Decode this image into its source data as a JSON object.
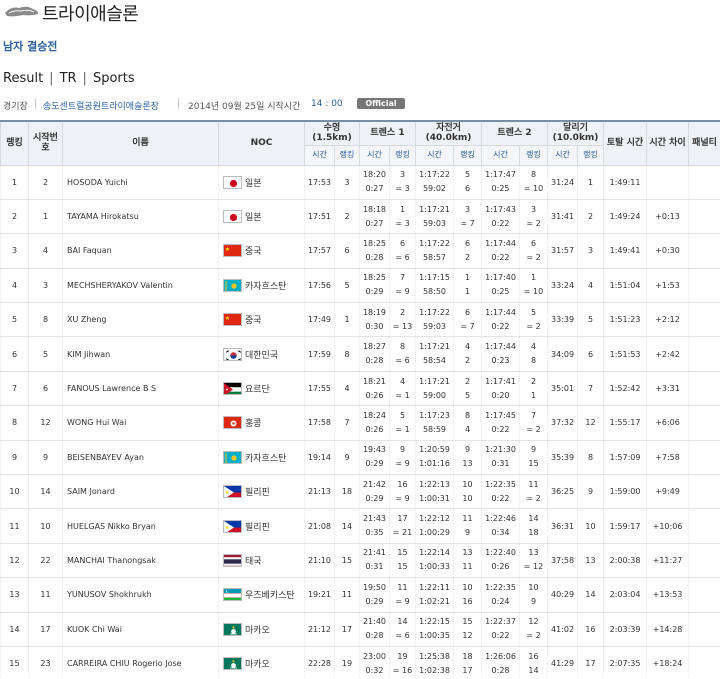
{
  "header": {
    "sport_title": "트라이애슬론",
    "logo_icon": "triathlon-hand-logo-icon"
  },
  "event": {
    "name": "남자 결승전"
  },
  "tabs": [
    {
      "label": "Result"
    },
    {
      "label": "TR"
    },
    {
      "label": "Sports"
    }
  ],
  "tab_separator": "|",
  "info": {
    "venue_label": "경기장",
    "venue": "송도센트럴공원트라이애슬론장",
    "date": "2014년 09월 25일  시작시간",
    "time": "14 : 00",
    "status_badge": "Official"
  },
  "columns": {
    "rank": "랭킹",
    "start_no": "시작번호",
    "name": "이름",
    "noc": "NOC",
    "swim": "수영(1.5km)",
    "t1": "트렌스 1",
    "bike": "자전거(40.0km)",
    "t2": "트렌스 2",
    "run": "달리기(10.0km)",
    "total": "토탈 시간",
    "diff": "시간 차이",
    "penalty": "패널티",
    "sub_time": "시간",
    "sub_rank": "랭킹"
  },
  "colors": {
    "header_bg": "#eef1f5",
    "accent_blue": "#2a5d9f",
    "badge_gray": "#777777"
  },
  "rows": [
    {
      "rank": "1",
      "start": "2",
      "name": "HOSODA Yuichi",
      "noc": "일본",
      "flag": "japan",
      "swim_time": "17:53",
      "swim_rank": "3",
      "t1_time": [
        "18:20",
        "0:27"
      ],
      "t1_rank": [
        "3",
        "= 3"
      ],
      "bike_time": [
        "1:17:22",
        "59:02"
      ],
      "bike_rank": [
        "5",
        "6"
      ],
      "t2_time": [
        "1:17:47",
        "0:25"
      ],
      "t2_rank": [
        "8",
        "= 10"
      ],
      "run_time": "31:24",
      "run_rank": "1",
      "total": "1:49:11",
      "diff": "",
      "penalty": ""
    },
    {
      "rank": "2",
      "start": "1",
      "name": "TAYAMA Hirokatsu",
      "noc": "일본",
      "flag": "japan",
      "swim_time": "17:51",
      "swim_rank": "2",
      "t1_time": [
        "18:18",
        "0:27"
      ],
      "t1_rank": [
        "1",
        "= 3"
      ],
      "bike_time": [
        "1:17:21",
        "59:03"
      ],
      "bike_rank": [
        "3",
        "= 7"
      ],
      "t2_time": [
        "1:17:43",
        "0:22"
      ],
      "t2_rank": [
        "3",
        "= 2"
      ],
      "run_time": "31:41",
      "run_rank": "2",
      "total": "1:49:24",
      "diff": "+0:13",
      "penalty": ""
    },
    {
      "rank": "3",
      "start": "4",
      "name": "BAI Faquan",
      "noc": "중국",
      "flag": "china",
      "swim_time": "17:57",
      "swim_rank": "6",
      "t1_time": [
        "18:25",
        "0:28"
      ],
      "t1_rank": [
        "6",
        "= 6"
      ],
      "bike_time": [
        "1:17:22",
        "58:57"
      ],
      "bike_rank": [
        "6",
        "2"
      ],
      "t2_time": [
        "1:17:44",
        "0:22"
      ],
      "t2_rank": [
        "6",
        "= 2"
      ],
      "run_time": "31:57",
      "run_rank": "3",
      "total": "1:49:41",
      "diff": "+0:30",
      "penalty": ""
    },
    {
      "rank": "4",
      "start": "3",
      "name": "MECHSHERYAKOV Valentin",
      "noc": "카자흐스탄",
      "flag": "kazakhstan",
      "swim_time": "17:56",
      "swim_rank": "5",
      "t1_time": [
        "18:25",
        "0:29"
      ],
      "t1_rank": [
        "7",
        "= 9"
      ],
      "bike_time": [
        "1:17:15",
        "58:50"
      ],
      "bike_rank": [
        "1",
        "1"
      ],
      "t2_time": [
        "1:17:40",
        "0:25"
      ],
      "t2_rank": [
        "1",
        "= 10"
      ],
      "run_time": "33:24",
      "run_rank": "4",
      "total": "1:51:04",
      "diff": "+1:53",
      "penalty": ""
    },
    {
      "rank": "5",
      "start": "8",
      "name": "XU Zheng",
      "noc": "중국",
      "flag": "china",
      "swim_time": "17:49",
      "swim_rank": "1",
      "t1_time": [
        "18:19",
        "0:30"
      ],
      "t1_rank": [
        "2",
        "= 13"
      ],
      "bike_time": [
        "1:17:22",
        "59:03"
      ],
      "bike_rank": [
        "6",
        "= 7"
      ],
      "t2_time": [
        "1:17:44",
        "0:22"
      ],
      "t2_rank": [
        "5",
        "= 2"
      ],
      "run_time": "33:39",
      "run_rank": "5",
      "total": "1:51:23",
      "diff": "+2:12",
      "penalty": ""
    },
    {
      "rank": "6",
      "start": "5",
      "name": "KIM Jihwan",
      "noc": "대한민국",
      "flag": "korea",
      "swim_time": "17:59",
      "swim_rank": "8",
      "t1_time": [
        "18:27",
        "0:28"
      ],
      "t1_rank": [
        "8",
        "= 6"
      ],
      "bike_time": [
        "1:17:21",
        "58:54"
      ],
      "bike_rank": [
        "4",
        "2"
      ],
      "t2_time": [
        "1:17:44",
        "0:23"
      ],
      "t2_rank": [
        "4",
        "8"
      ],
      "run_time": "34:09",
      "run_rank": "6",
      "total": "1:51:53",
      "diff": "+2:42",
      "penalty": ""
    },
    {
      "rank": "7",
      "start": "6",
      "name": "FANOUS Lawrence B S",
      "noc": "요르단",
      "flag": "jordan",
      "swim_time": "17:55",
      "swim_rank": "4",
      "t1_time": [
        "18:21",
        "0:26"
      ],
      "t1_rank": [
        "4",
        "= 1"
      ],
      "bike_time": [
        "1:17:21",
        "59:00"
      ],
      "bike_rank": [
        "2",
        "5"
      ],
      "t2_time": [
        "1:17:41",
        "0:20"
      ],
      "t2_rank": [
        "2",
        "1"
      ],
      "run_time": "35:01",
      "run_rank": "7",
      "total": "1:52:42",
      "diff": "+3:31",
      "penalty": ""
    },
    {
      "rank": "8",
      "start": "12",
      "name": "WONG Hui Wai",
      "noc": "홍콩",
      "flag": "hongkong",
      "swim_time": "17:58",
      "swim_rank": "7",
      "t1_time": [
        "18:24",
        "0:26"
      ],
      "t1_rank": [
        "5",
        "= 1"
      ],
      "bike_time": [
        "1:17:23",
        "58:59"
      ],
      "bike_rank": [
        "8",
        "4"
      ],
      "t2_time": [
        "1:17:45",
        "0:22"
      ],
      "t2_rank": [
        "7",
        "= 2"
      ],
      "run_time": "37:32",
      "run_rank": "12",
      "total": "1:55:17",
      "diff": "+6:06",
      "penalty": ""
    },
    {
      "rank": "9",
      "start": "9",
      "name": "BEISENBAYEV Ayan",
      "noc": "카자흐스탄",
      "flag": "kazakhstan",
      "swim_time": "19:14",
      "swim_rank": "9",
      "t1_time": [
        "19:43",
        "0:29"
      ],
      "t1_rank": [
        "9",
        "= 9"
      ],
      "bike_time": [
        "1:20:59",
        "1:01:16"
      ],
      "bike_rank": [
        "9",
        "13"
      ],
      "t2_time": [
        "1:21:30",
        "0:31"
      ],
      "t2_rank": [
        "9",
        "15"
      ],
      "run_time": "35:39",
      "run_rank": "8",
      "total": "1:57:09",
      "diff": "+7:58",
      "penalty": ""
    },
    {
      "rank": "10",
      "start": "14",
      "name": "SAIM Jonard",
      "noc": "필리핀",
      "flag": "philippines",
      "swim_time": "21:13",
      "swim_rank": "18",
      "t1_time": [
        "21:42",
        "0:29"
      ],
      "t1_rank": [
        "16",
        "= 9"
      ],
      "bike_time": [
        "1:22:13",
        "1:00:31"
      ],
      "bike_rank": [
        "10",
        "10"
      ],
      "t2_time": [
        "1:22:35",
        "0:22"
      ],
      "t2_rank": [
        "11",
        "= 2"
      ],
      "run_time": "36:25",
      "run_rank": "9",
      "total": "1:59:00",
      "diff": "+9:49",
      "penalty": ""
    },
    {
      "rank": "11",
      "start": "10",
      "name": "HUELGAS Nikko Bryan",
      "noc": "필리핀",
      "flag": "philippines",
      "swim_time": "21:08",
      "swim_rank": "14",
      "t1_time": [
        "21:43",
        "0:35"
      ],
      "t1_rank": [
        "17",
        "= 21"
      ],
      "bike_time": [
        "1:22:12",
        "1:00:29"
      ],
      "bike_rank": [
        "11",
        "9"
      ],
      "t2_time": [
        "1:22:46",
        "0:34"
      ],
      "t2_rank": [
        "14",
        "18"
      ],
      "run_time": "36:31",
      "run_rank": "10",
      "total": "1:59:17",
      "diff": "+10:06",
      "penalty": ""
    },
    {
      "rank": "12",
      "start": "22",
      "name": "MANCHAI Thanongsak",
      "noc": "태국",
      "flag": "thailand",
      "swim_time": "21:10",
      "swim_rank": "15",
      "t1_time": [
        "21:41",
        "0:31"
      ],
      "t1_rank": [
        "15",
        "15"
      ],
      "bike_time": [
        "1:22:14",
        "1:00:33"
      ],
      "bike_rank": [
        "13",
        "11"
      ],
      "t2_time": [
        "1:22:40",
        "0:26"
      ],
      "t2_rank": [
        "13",
        "= 12"
      ],
      "run_time": "37:58",
      "run_rank": "13",
      "total": "2:00:38",
      "diff": "+11:27",
      "penalty": ""
    },
    {
      "rank": "13",
      "start": "11",
      "name": "YUNUSOV Shokhrukh",
      "noc": "우즈베키스탄",
      "flag": "uzbekistan",
      "swim_time": "19:21",
      "swim_rank": "11",
      "t1_time": [
        "19:50",
        "0:29"
      ],
      "t1_rank": [
        "11",
        "= 9"
      ],
      "bike_time": [
        "1:22:11",
        "1:02:21"
      ],
      "bike_rank": [
        "10",
        "16"
      ],
      "t2_time": [
        "1:22:35",
        "0:24"
      ],
      "t2_rank": [
        "10",
        "9"
      ],
      "run_time": "40:29",
      "run_rank": "14",
      "total": "2:03:04",
      "diff": "+13:53",
      "penalty": ""
    },
    {
      "rank": "14",
      "start": "17",
      "name": "KUOK Chi Wai",
      "noc": "마카오",
      "flag": "macau",
      "swim_time": "21:12",
      "swim_rank": "17",
      "t1_time": [
        "21:40",
        "0:28"
      ],
      "t1_rank": [
        "14",
        "= 6"
      ],
      "bike_time": [
        "1:22:15",
        "1:00:35"
      ],
      "bike_rank": [
        "15",
        "12"
      ],
      "t2_time": [
        "1:22:37",
        "0:22"
      ],
      "t2_rank": [
        "12",
        "= 2"
      ],
      "run_time": "41:02",
      "run_rank": "16",
      "total": "2:03:39",
      "diff": "+14:28",
      "penalty": ""
    },
    {
      "rank": "15",
      "start": "23",
      "name": "CARREIRA CHIU Rogerio Jose",
      "noc": "마카오",
      "flag": "macau",
      "swim_time": "22:28",
      "swim_rank": "19",
      "t1_time": [
        "23:00",
        "0:32"
      ],
      "t1_rank": [
        "19",
        "= 16"
      ],
      "bike_time": [
        "1:25:38",
        "1:02:38"
      ],
      "bike_rank": [
        "18",
        "17"
      ],
      "t2_time": [
        "1:26:06",
        "0:28"
      ],
      "t2_rank": [
        "16",
        "14"
      ],
      "run_time": "41:29",
      "run_rank": "17",
      "total": "2:07:35",
      "diff": "+18:24",
      "penalty": ""
    }
  ]
}
